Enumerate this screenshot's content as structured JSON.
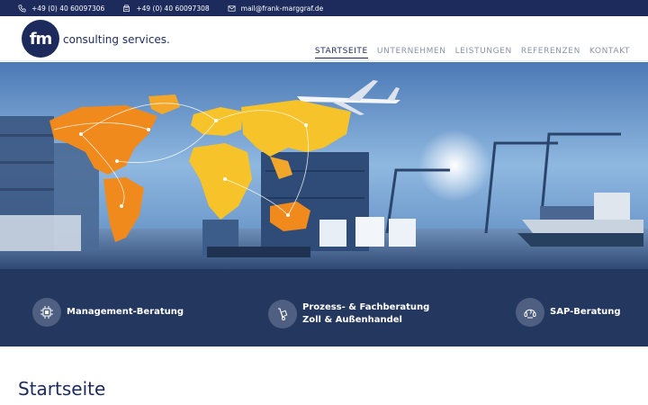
{
  "topbar": {
    "phone": "+49 (0) 40 60097306",
    "fax": "+49 (0) 40 60097308",
    "email": "mail@frank-marggraf.de",
    "icons": [
      "phone-icon",
      "fax-icon",
      "mail-icon"
    ]
  },
  "header": {
    "logo_mark": "fm",
    "logo_text": "consulting services.",
    "nav": [
      "STARTSEITE",
      "UNTERNEHMEN",
      "LEISTUNGEN",
      "REFERENZEN",
      "KONTAKT"
    ],
    "active_nav": "STARTSEITE"
  },
  "hero": {
    "image_subject": "world map with logistics: airplane, containers, trucks, cargo ship"
  },
  "services": [
    {
      "line1": "Management-Beratung",
      "line2": "",
      "icon": "chip-icon"
    },
    {
      "line1": "Prozess- & Fachberatung",
      "line2": "Zoll & Außenhandel",
      "icon": "hand-truck-icon"
    },
    {
      "line1": "SAP-Beratung",
      "line2": "",
      "icon": "headset-icon"
    }
  ],
  "content": {
    "title": "Startseite"
  },
  "colors": {
    "navy": "#1c2b5c",
    "band": "#24375f",
    "map_orange": "#f08a1c",
    "map_yellow": "#f6c32b"
  }
}
